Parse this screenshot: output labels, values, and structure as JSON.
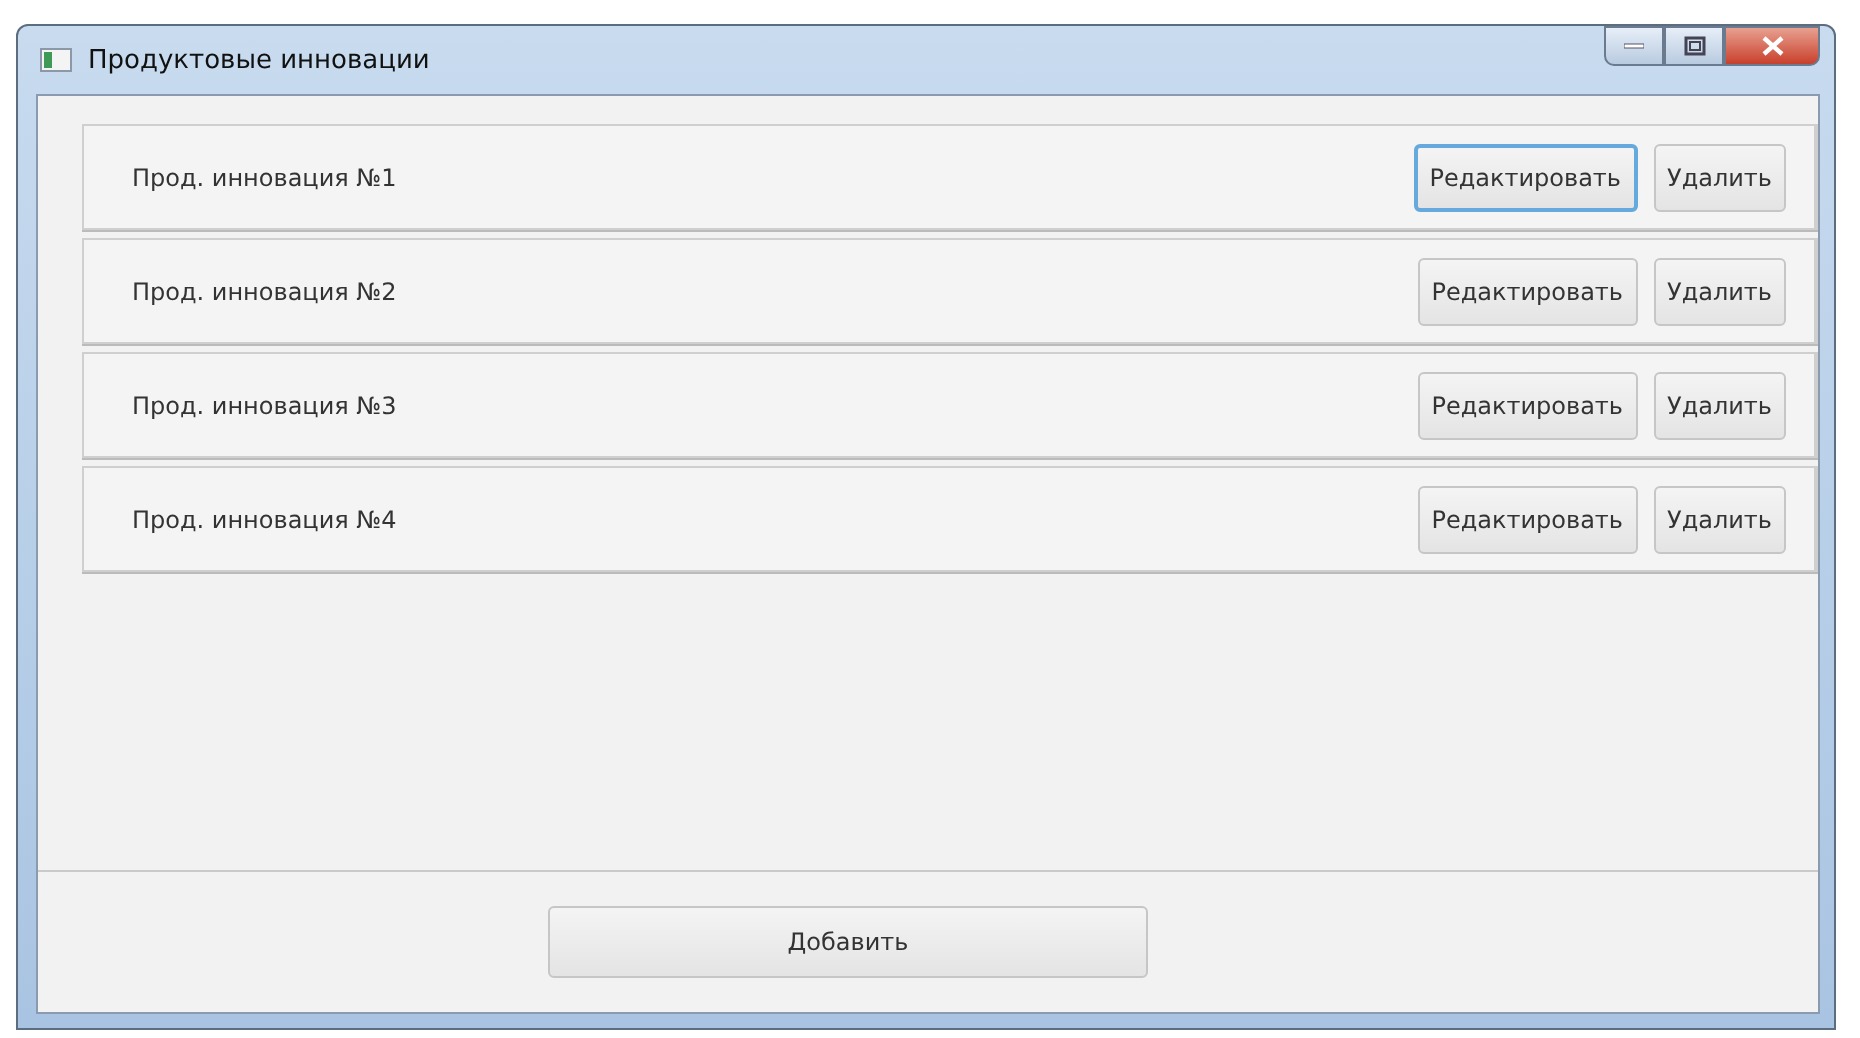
{
  "window": {
    "title": "Продуктовые инновации"
  },
  "items": [
    {
      "name": "Прод. инновация №1",
      "edit_label": "Редактировать",
      "delete_label": "Удалить",
      "edit_focused": true
    },
    {
      "name": "Прод. инновация №2",
      "edit_label": "Редактировать",
      "delete_label": "Удалить",
      "edit_focused": false
    },
    {
      "name": "Прод. инновация №3",
      "edit_label": "Редактировать",
      "delete_label": "Удалить",
      "edit_focused": false
    },
    {
      "name": "Прод. инновация №4",
      "edit_label": "Редактировать",
      "delete_label": "Удалить",
      "edit_focused": false
    }
  ],
  "add_button": "Добавить"
}
